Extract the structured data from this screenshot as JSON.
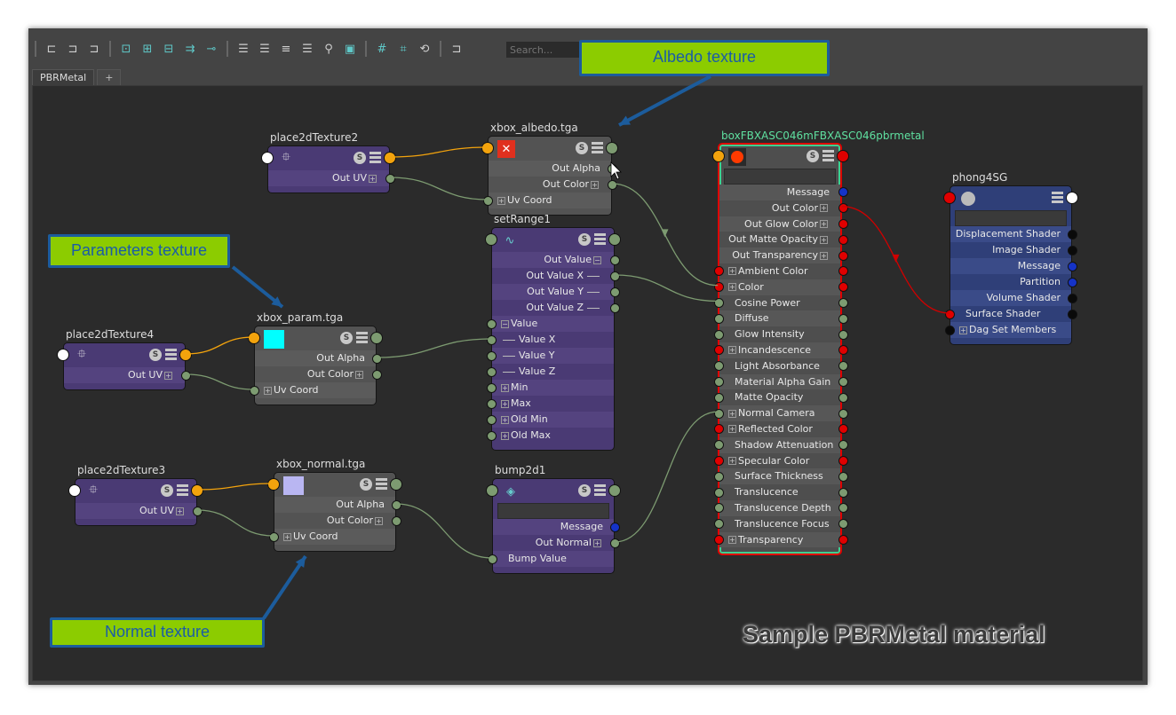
{
  "tabs": [
    {
      "label": "PBRMetal"
    },
    {
      "label": "+"
    }
  ],
  "toolbar": {
    "search_placeholder": "Search...",
    "icons": [
      "input-connections-icon",
      "input-output-connections-icon",
      "output-connections-icon",
      "|",
      "select-all-icon",
      "add-selected-icon",
      "remove-selected-icon",
      "graph-layout-icon",
      "pin-icon",
      "|",
      "simple-mode-icon",
      "connected-mode-icon",
      "full-mode-icon",
      "custom-mode-icon",
      "search-icon",
      "frame-icon",
      "|",
      "grid-icon",
      "snap-grid-icon",
      "sync-icon",
      "|",
      "toggle-panel-icon"
    ]
  },
  "colors": {
    "port_green": "#7d9b71",
    "port_red": "#e00000",
    "port_blue": "#1533c8",
    "port_black": "#0a0a0a",
    "port_orange": "#f3a30d",
    "port_white": "#ffffff",
    "wire_green": "#7d9b71",
    "wire_orange": "#f3a30d",
    "wire_red": "#d00000",
    "callout_bg": "#8ccc00",
    "callout_border": "#1c5c9c",
    "selected_label": "#5fe0a0"
  },
  "nodes": [
    {
      "id": "place2dTexture2",
      "name": "place2dTexture2",
      "kind": "utility",
      "header": {
        "in": "#ffffff",
        "out": "#f3a30d",
        "icon": "place2d-icon"
      },
      "field": false,
      "rows": [
        {
          "label": "Out UV",
          "out": "#7d9b71",
          "expand": "+"
        }
      ]
    },
    {
      "id": "xbox_albedo",
      "name": "xbox_albedo.tga",
      "kind": "texture",
      "header": {
        "in": "#f3a30d",
        "out": "#7d9b71",
        "icon": "missing-texture-icon"
      },
      "field": false,
      "rows": [
        {
          "label": "Out Alpha",
          "out": "#7d9b71"
        },
        {
          "label": "Out Color",
          "out": "#7d9b71",
          "expand": "+"
        },
        {
          "label": "Uv Coord",
          "in": "#7d9b71",
          "expand": "+"
        }
      ]
    },
    {
      "id": "setRange1",
      "name": "setRange1",
      "kind": "utility",
      "header": {
        "in": "#7d9b71",
        "out": "#7d9b71",
        "icon": "setrange-icon"
      },
      "field": false,
      "rows": [
        {
          "label": "Out Value",
          "out": "#7d9b71",
          "expand": "-"
        },
        {
          "label": "Out Value X",
          "out": "#7d9b71",
          "tree": true
        },
        {
          "label": "Out Value Y",
          "out": "#7d9b71",
          "tree": true
        },
        {
          "label": "Out Value Z",
          "out": "#7d9b71",
          "tree": true
        },
        {
          "label": "Value",
          "in": "#7d9b71",
          "expand": "-"
        },
        {
          "label": "Value X",
          "in": "#7d9b71",
          "tree": true
        },
        {
          "label": "Value Y",
          "in": "#7d9b71",
          "tree": true
        },
        {
          "label": "Value Z",
          "in": "#7d9b71",
          "tree": true
        },
        {
          "label": "Min",
          "in": "#7d9b71",
          "expand": "+"
        },
        {
          "label": "Max",
          "in": "#7d9b71",
          "expand": "+"
        },
        {
          "label": "Old Min",
          "in": "#7d9b71",
          "expand": "+"
        },
        {
          "label": "Old Max",
          "in": "#7d9b71",
          "expand": "+"
        }
      ]
    },
    {
      "id": "place2dTexture4",
      "name": "place2dTexture4",
      "kind": "utility",
      "header": {
        "in": "#ffffff",
        "out": "#f3a30d",
        "icon": "place2d-icon"
      },
      "field": false,
      "rows": [
        {
          "label": "Out UV",
          "out": "#7d9b71",
          "expand": "+"
        }
      ]
    },
    {
      "id": "xbox_param",
      "name": "xbox_param.tga",
      "kind": "texture",
      "header": {
        "in": "#f3a30d",
        "out": "#7d9b71",
        "icon": "texture-swatch-cyan",
        "swatch": "#00ffff"
      },
      "field": false,
      "rows": [
        {
          "label": "Out Alpha",
          "out": "#7d9b71"
        },
        {
          "label": "Out Color",
          "out": "#7d9b71",
          "expand": "+"
        },
        {
          "label": "Uv Coord",
          "in": "#7d9b71",
          "expand": "+"
        }
      ]
    },
    {
      "id": "place2dTexture3",
      "name": "place2dTexture3",
      "kind": "utility",
      "header": {
        "in": "#ffffff",
        "out": "#f3a30d",
        "icon": "place2d-icon"
      },
      "field": false,
      "rows": [
        {
          "label": "Out UV",
          "out": "#7d9b71",
          "expand": "+"
        }
      ]
    },
    {
      "id": "xbox_normal",
      "name": "xbox_normal.tga",
      "kind": "texture",
      "header": {
        "in": "#f3a30d",
        "out": "#7d9b71",
        "icon": "texture-swatch-lavender",
        "swatch": "#b9b6f2"
      },
      "field": false,
      "rows": [
        {
          "label": "Out Alpha",
          "out": "#7d9b71"
        },
        {
          "label": "Out Color",
          "out": "#7d9b71",
          "expand": "+"
        },
        {
          "label": "Uv Coord",
          "in": "#7d9b71",
          "expand": "+"
        }
      ]
    },
    {
      "id": "bump2d1",
      "name": "bump2d1",
      "kind": "utility",
      "header": {
        "in": "#7d9b71",
        "out": "#7d9b71",
        "icon": "bump-icon"
      },
      "field": true,
      "rows": [
        {
          "label": "Message",
          "out": "#1533c8"
        },
        {
          "label": "Out Normal",
          "out": "#7d9b71",
          "expand": "+"
        },
        {
          "label": "Bump Value",
          "in": "#7d9b71"
        }
      ]
    },
    {
      "id": "pbrmetal",
      "name": "boxFBXASC046mFBXASC046pbrmetal",
      "kind": "shader",
      "selected": true,
      "header": {
        "in": "#f3a30d",
        "out": "#e00000",
        "icon": "shader-sphere-icon"
      },
      "field": true,
      "rows": [
        {
          "label": "Message",
          "out": "#1533c8"
        },
        {
          "label": "Out Color",
          "out": "#e00000",
          "expand": "+"
        },
        {
          "label": "Out Glow Color",
          "out": "#e00000",
          "expand": "+"
        },
        {
          "label": "Out Matte Opacity",
          "out": "#e00000",
          "expand": "+"
        },
        {
          "label": "Out Transparency",
          "out": "#e00000",
          "expand": "+"
        },
        {
          "label": "Ambient Color",
          "in": "#e00000",
          "out": "#e00000",
          "expand": "+"
        },
        {
          "label": "Color",
          "in": "#e00000",
          "out": "#e00000",
          "expand": "+"
        },
        {
          "label": "Cosine Power",
          "in": "#7d9b71",
          "out": "#7d9b71"
        },
        {
          "label": "Diffuse",
          "in": "#7d9b71",
          "out": "#7d9b71"
        },
        {
          "label": "Glow Intensity",
          "in": "#7d9b71",
          "out": "#7d9b71"
        },
        {
          "label": "Incandescence",
          "in": "#e00000",
          "out": "#e00000",
          "expand": "+"
        },
        {
          "label": "Light Absorbance",
          "in": "#7d9b71",
          "out": "#7d9b71"
        },
        {
          "label": "Material Alpha Gain",
          "in": "#7d9b71",
          "out": "#7d9b71"
        },
        {
          "label": "Matte Opacity",
          "in": "#7d9b71",
          "out": "#7d9b71"
        },
        {
          "label": "Normal Camera",
          "in": "#7d9b71",
          "out": "#7d9b71",
          "expand": "+"
        },
        {
          "label": "Reflected Color",
          "in": "#e00000",
          "out": "#e00000",
          "expand": "+"
        },
        {
          "label": "Shadow Attenuation",
          "in": "#7d9b71",
          "out": "#7d9b71"
        },
        {
          "label": "Specular Color",
          "in": "#e00000",
          "out": "#e00000",
          "expand": "+"
        },
        {
          "label": "Surface Thickness",
          "in": "#7d9b71",
          "out": "#7d9b71"
        },
        {
          "label": "Translucence",
          "in": "#7d9b71",
          "out": "#7d9b71"
        },
        {
          "label": "Translucence Depth",
          "in": "#7d9b71",
          "out": "#7d9b71"
        },
        {
          "label": "Translucence Focus",
          "in": "#7d9b71",
          "out": "#7d9b71"
        },
        {
          "label": "Transparency",
          "in": "#e00000",
          "out": "#e00000",
          "expand": "+"
        }
      ]
    },
    {
      "id": "phong4SG",
      "name": "phong4SG",
      "kind": "shadingGroup",
      "header": {
        "in": "#e00000",
        "out": "#ffffff",
        "icon": "shading-group-icon",
        "nosbtn": true
      },
      "field": true,
      "rows": [
        {
          "label": "Displacement Shader",
          "out": "#0a0a0a"
        },
        {
          "label": "Image Shader",
          "out": "#0a0a0a"
        },
        {
          "label": "Message",
          "out": "#1533c8"
        },
        {
          "label": "Partition",
          "out": "#1533c8"
        },
        {
          "label": "Volume Shader",
          "out": "#0a0a0a"
        },
        {
          "label": "Surface Shader",
          "in": "#e00000",
          "out": "#0a0a0a"
        },
        {
          "label": "Dag Set Members",
          "in": "#0a0a0a",
          "expand": "+"
        }
      ]
    }
  ],
  "annotations": [
    {
      "text": "Albedo texture"
    },
    {
      "text": "Parameters texture"
    },
    {
      "text": "Normal texture"
    }
  ],
  "caption": "Sample PBRMetal material"
}
